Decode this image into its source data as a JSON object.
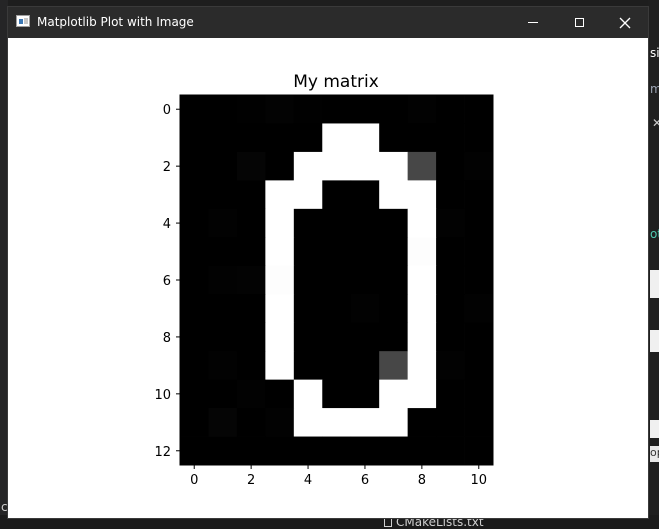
{
  "window": {
    "title": "Matplotlib Plot with Image"
  },
  "icons": {
    "app": "matplotlib-window-icon",
    "minimize": "minimize-icon",
    "maximize": "maximize-icon",
    "close": "close-icon"
  },
  "background": {
    "bottom_file": "CMakeLists.txt",
    "left_fragment": "c",
    "right_fragment_1": "si",
    "right_fragment_2": "ma",
    "right_fragment_3": "ot",
    "right_fragment_4": "op"
  },
  "chart_data": {
    "type": "heatmap",
    "title": "My matrix",
    "colormap": "gray",
    "xlabel": "",
    "ylabel": "",
    "x_ticks": [
      0,
      2,
      4,
      6,
      8,
      10
    ],
    "y_ticks": [
      0,
      2,
      4,
      6,
      8,
      10,
      12
    ],
    "xlim": [
      -0.5,
      10.5
    ],
    "ylim": [
      12.5,
      -0.5
    ],
    "grid": false,
    "matrix": [
      [
        0,
        0,
        1,
        3,
        1,
        0,
        0,
        0,
        2,
        0,
        0
      ],
      [
        0,
        0,
        0,
        0,
        0,
        252,
        252,
        0,
        0,
        0,
        0
      ],
      [
        0,
        0,
        5,
        0,
        252,
        252,
        252,
        252,
        70,
        0,
        2
      ],
      [
        0,
        0,
        0,
        252,
        252,
        0,
        0,
        252,
        252,
        0,
        0
      ],
      [
        0,
        2,
        0,
        252,
        0,
        0,
        0,
        0,
        252,
        2,
        0
      ],
      [
        0,
        0,
        0,
        252,
        0,
        0,
        0,
        0,
        250,
        0,
        0
      ],
      [
        0,
        2,
        3,
        250,
        0,
        0,
        0,
        0,
        252,
        0,
        0
      ],
      [
        0,
        0,
        0,
        252,
        0,
        0,
        2,
        0,
        252,
        0,
        2
      ],
      [
        0,
        0,
        0,
        252,
        0,
        0,
        0,
        0,
        252,
        0,
        0
      ],
      [
        0,
        2,
        0,
        252,
        0,
        0,
        0,
        70,
        252,
        2,
        0
      ],
      [
        0,
        0,
        2,
        0,
        252,
        0,
        0,
        252,
        252,
        0,
        0
      ],
      [
        0,
        5,
        0,
        2,
        252,
        252,
        252,
        252,
        0,
        0,
        0
      ],
      [
        0,
        0,
        0,
        0,
        0,
        0,
        0,
        0,
        0,
        0,
        0
      ]
    ]
  }
}
